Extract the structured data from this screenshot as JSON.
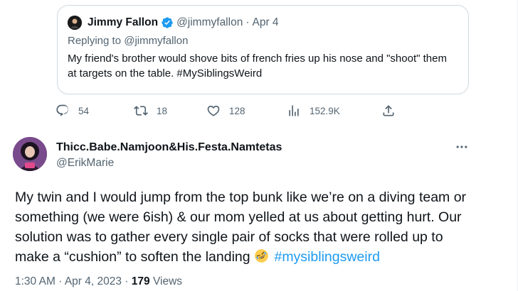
{
  "quoted_tweet": {
    "author_name": "Jimmy Fallon",
    "handle": "@jimmyfallon",
    "separator": "·",
    "date": "Apr 4",
    "replying_to": "Replying to @jimmyfallon",
    "text": "My friend's brother would shove bits of french fries up his nose and \"shoot\" them at targets on the table. #MySiblingsWeird"
  },
  "actions": {
    "replies": "54",
    "retweets": "18",
    "likes": "128",
    "views": "152.9K"
  },
  "main_tweet": {
    "author_name": "Thicc.Babe.Namjoon&His.Festa.Namtetas",
    "handle": "@ErikMarie",
    "text_before_emoji": "My twin and I would jump from the top bunk like we’re on a diving team or something (we were 6ish) & our mom yelled at us about getting hurt. Our solution was to gather every single pair of socks that were rolled up to make a “cushion” to soften the landing ",
    "hashtag": "#mysiblingsweird",
    "time": "1:30 AM",
    "separator": "·",
    "date": "Apr 4, 2023",
    "views_count": "179",
    "views_label": "Views"
  },
  "colors": {
    "accent": "#1d9bf0",
    "secondary_text": "#536471",
    "primary_text": "#0f1419",
    "border": "#cfd9de"
  },
  "icons": [
    "verified-badge-icon",
    "reply-icon",
    "retweet-icon",
    "like-icon",
    "views-icon",
    "share-icon",
    "more-icon",
    "rofl-emoji"
  ]
}
